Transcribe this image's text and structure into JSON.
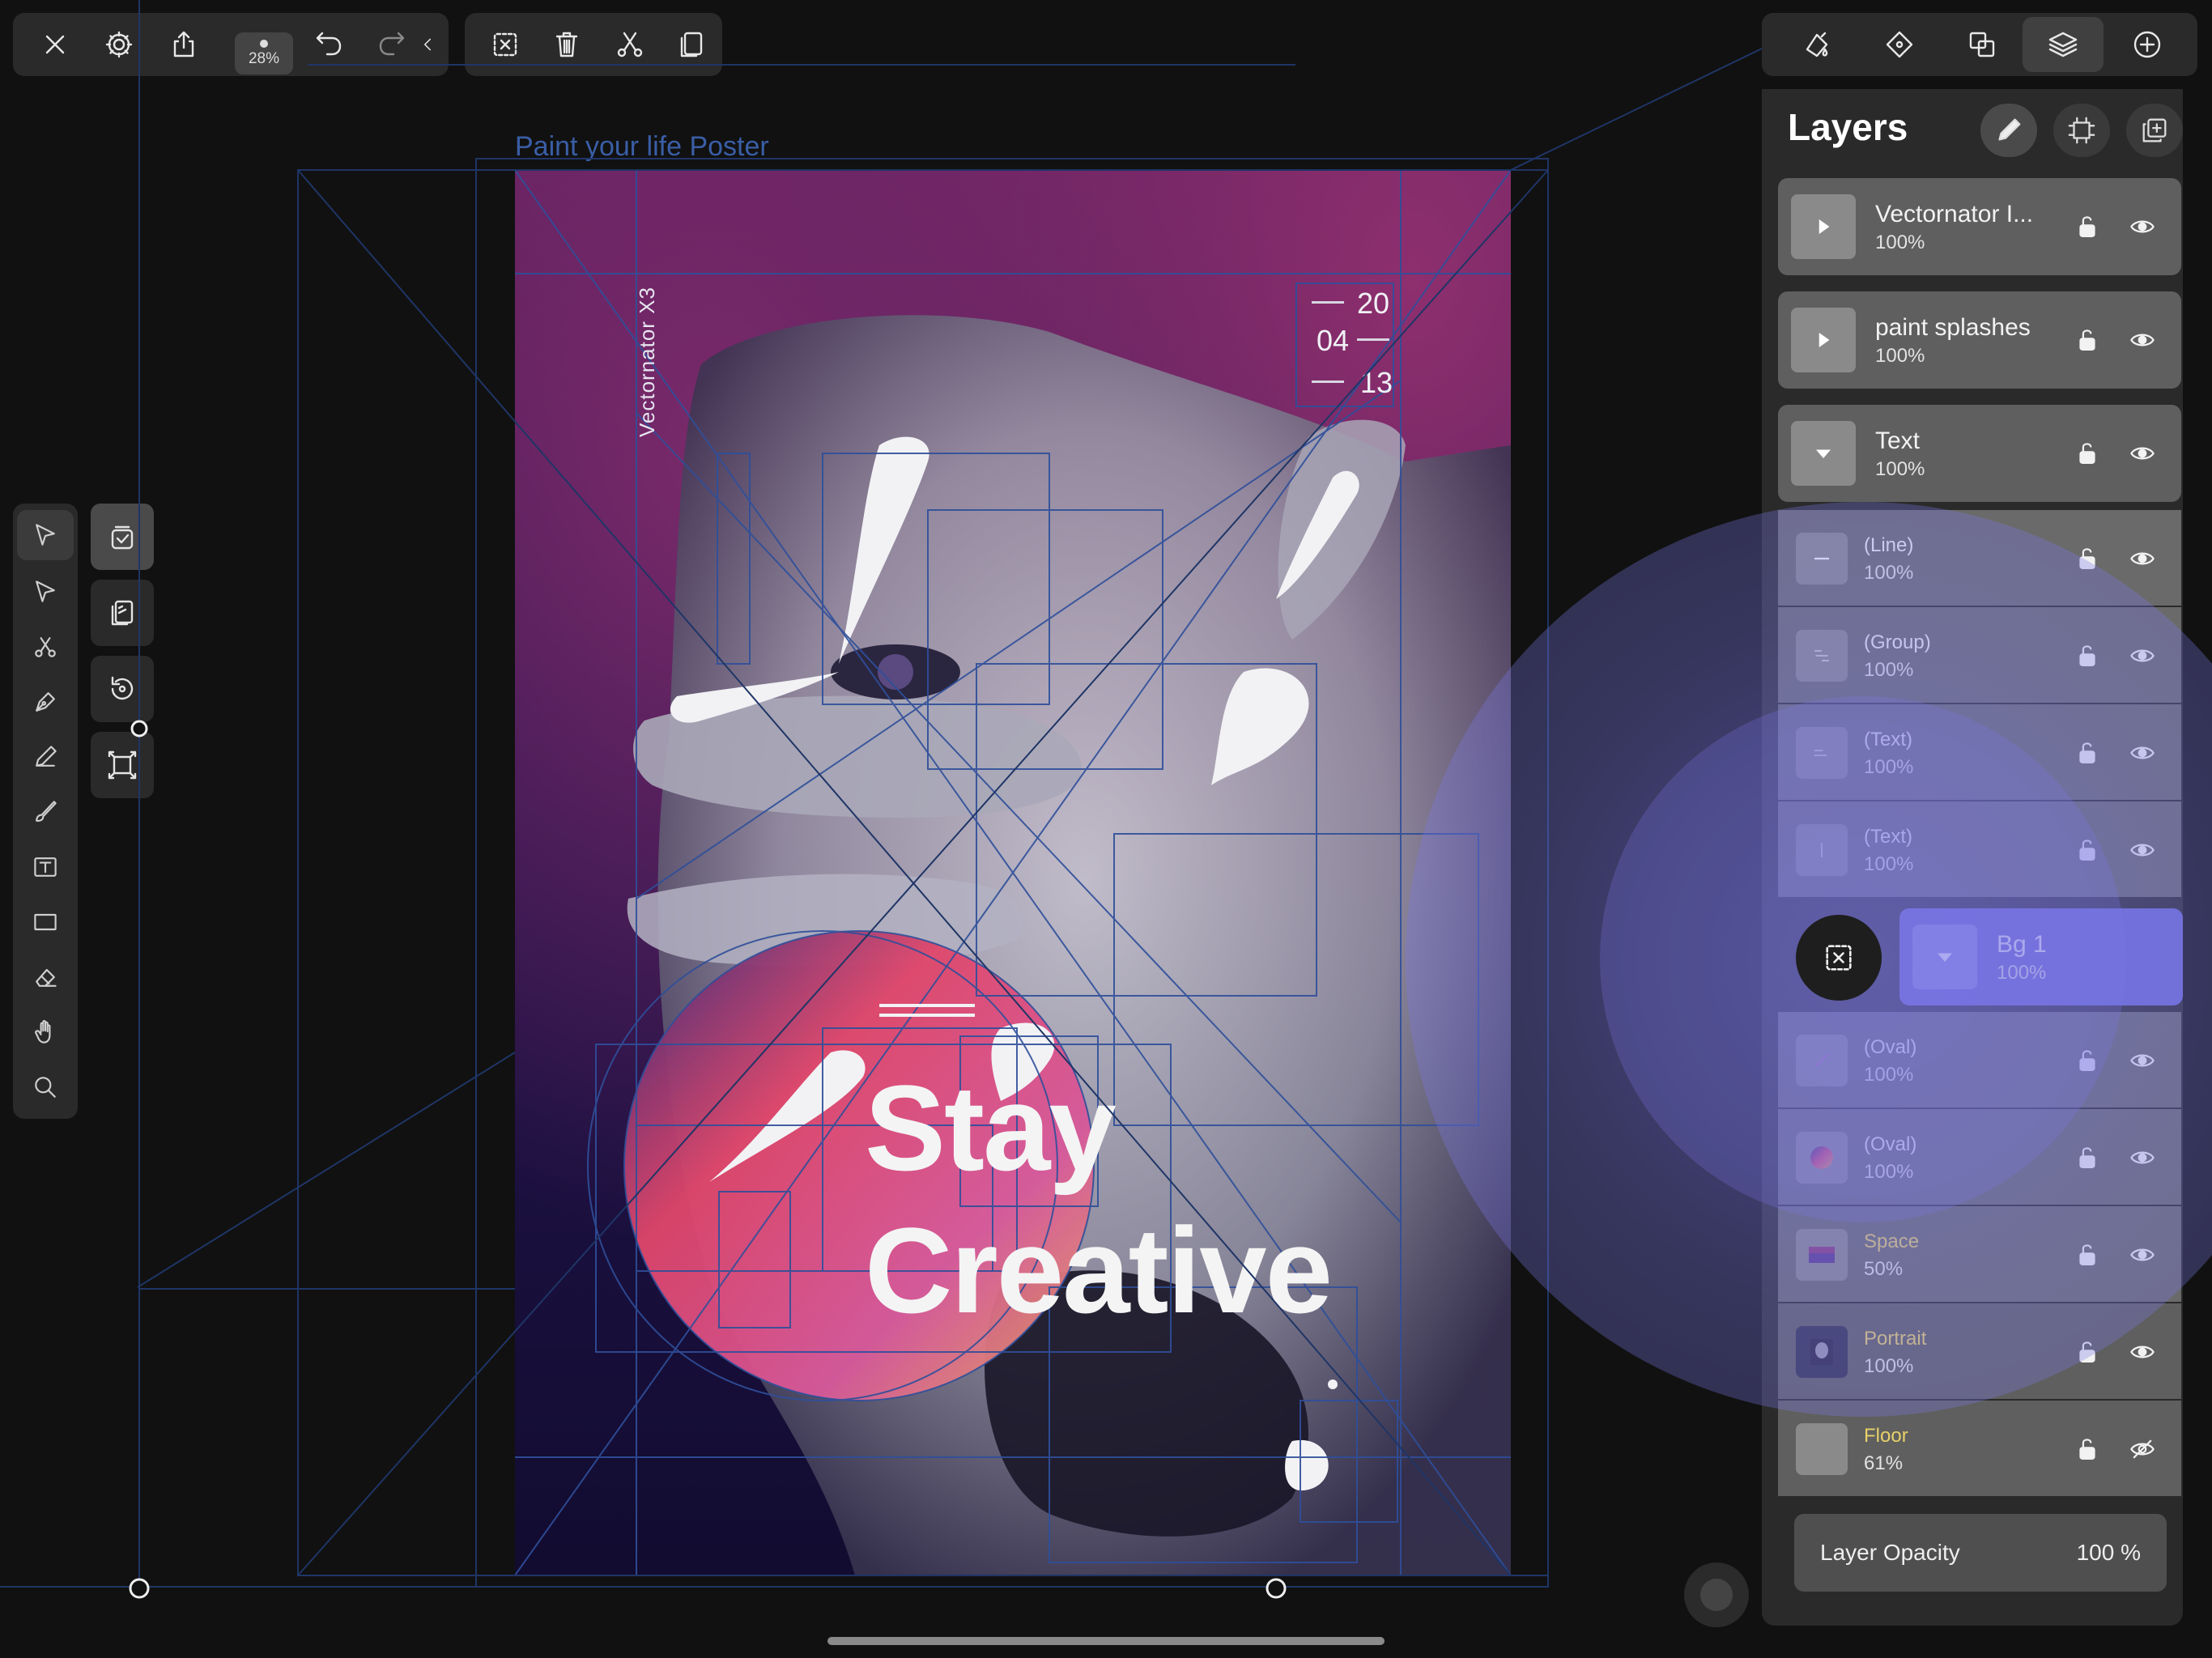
{
  "top_toolbar": {
    "zoom_label": "28%"
  },
  "document": {
    "title": "Paint your life Poster",
    "vertical_text": "Vectornator X3",
    "date": {
      "day": "20",
      "month": "04",
      "year": "13"
    },
    "headline_line1": "Stay",
    "headline_line2": "Creative"
  },
  "layers_panel": {
    "title": "Layers",
    "layers": [
      {
        "name": "Vectornator I...",
        "opacity": "100%",
        "thumb": "play-icon",
        "visible": true
      },
      {
        "name": "paint splashes",
        "opacity": "100%",
        "thumb": "play-icon",
        "visible": true
      },
      {
        "name": "Text",
        "opacity": "100%",
        "thumb": "chevron-down-icon",
        "visible": true
      },
      {
        "name": "(Line)",
        "opacity": "100%",
        "thumb": "line-icon",
        "visible": true
      },
      {
        "name": "(Group)",
        "opacity": "100%",
        "thumb": "group-icon",
        "visible": true
      },
      {
        "name": "(Text)",
        "opacity": "100%",
        "thumb": "text-thumb",
        "visible": true
      },
      {
        "name": "(Text)",
        "opacity": "100%",
        "thumb": "text-thumb",
        "visible": true
      },
      {
        "name": "Bg 1",
        "opacity": "100%",
        "thumb": "chevron-down-icon",
        "visible": true
      },
      {
        "name": "(Oval)",
        "opacity": "100%",
        "thumb": "oval-thumb",
        "visible": true
      },
      {
        "name": "(Oval)",
        "opacity": "100%",
        "thumb": "oval-gradient-thumb",
        "visible": true
      },
      {
        "name": "Space",
        "opacity": "50%",
        "thumb": "space-thumb",
        "visible": true
      },
      {
        "name": "Portrait",
        "opacity": "100%",
        "thumb": "portrait-thumb",
        "visible": true
      },
      {
        "name": "Floor",
        "opacity": "61%",
        "thumb": "floor-thumb",
        "visible": false
      }
    ],
    "opacity_label": "Layer Opacity",
    "opacity_value": "100 %"
  },
  "colors": {
    "background": "#111111",
    "panel": "#2a2a2a",
    "guide_blue": "#2f4f9a",
    "highlight": "#7a78e8"
  }
}
